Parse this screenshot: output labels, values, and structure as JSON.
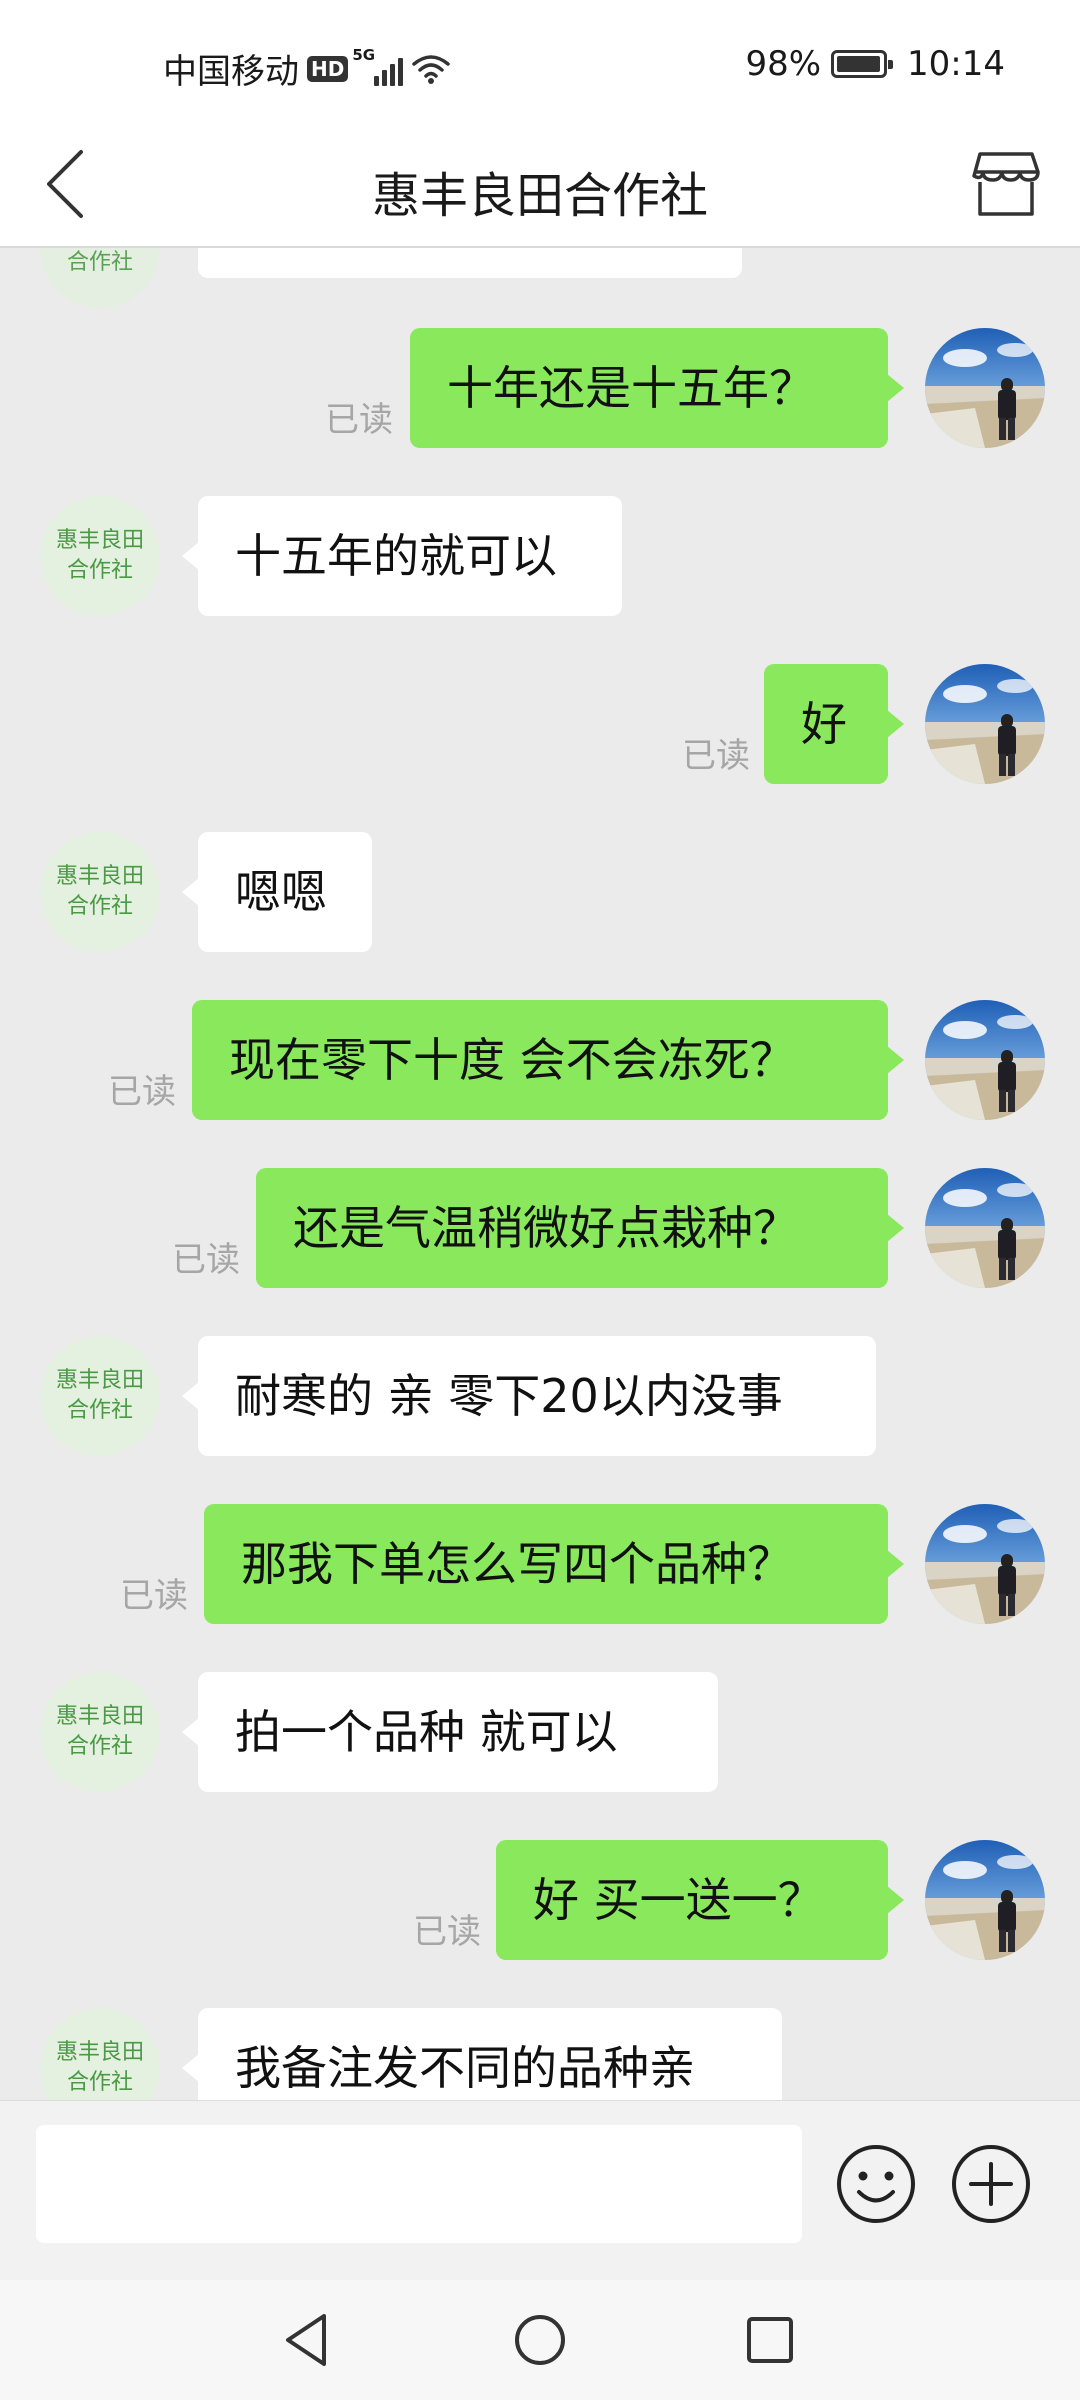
{
  "status_bar": {
    "carrier": "中国移动",
    "hd": "HD",
    "network": "5G",
    "battery": "98%",
    "battery_level": 0.98,
    "time": "10:14"
  },
  "header": {
    "title": "惠丰良田合作社",
    "back_icon": "chevron-left-icon",
    "shop_icon": "store-icon"
  },
  "shop_avatar": {
    "line1": "惠丰良田",
    "line2": "合作社"
  },
  "messages": [
    {
      "from": "user",
      "text": "十年还是十五年？",
      "status": "已读"
    },
    {
      "from": "shop",
      "text": "十五年的就可以"
    },
    {
      "from": "user",
      "text": "好",
      "status": "已读"
    },
    {
      "from": "shop",
      "text": "嗯嗯"
    },
    {
      "from": "user",
      "text": "现在零下十度 会不会冻死？",
      "status": "已读"
    },
    {
      "from": "user",
      "text": "还是气温稍微好点栽种？",
      "status": "已读"
    },
    {
      "from": "shop",
      "text": "耐寒的 亲  零下20以内没事"
    },
    {
      "from": "user",
      "text": "那我下单怎么写四个品种？",
      "status": "已读"
    },
    {
      "from": "shop",
      "text": "拍一个品种  就可以"
    },
    {
      "from": "user",
      "text": "好 买一送一？",
      "status": "已读"
    },
    {
      "from": "shop",
      "text": "我备注发不同的品种亲"
    }
  ],
  "input": {
    "placeholder": "",
    "emoji_icon": "smiley-icon",
    "plus_icon": "plus-circle-icon"
  },
  "system_nav": {
    "back": "triangle-back-icon",
    "home": "circle-home-icon",
    "recents": "square-recents-icon"
  },
  "colors": {
    "user_bubble": "#89e85c",
    "shop_bubble": "#ffffff",
    "chat_bg": "#ebebeb",
    "shop_text": "#4a9a44"
  }
}
